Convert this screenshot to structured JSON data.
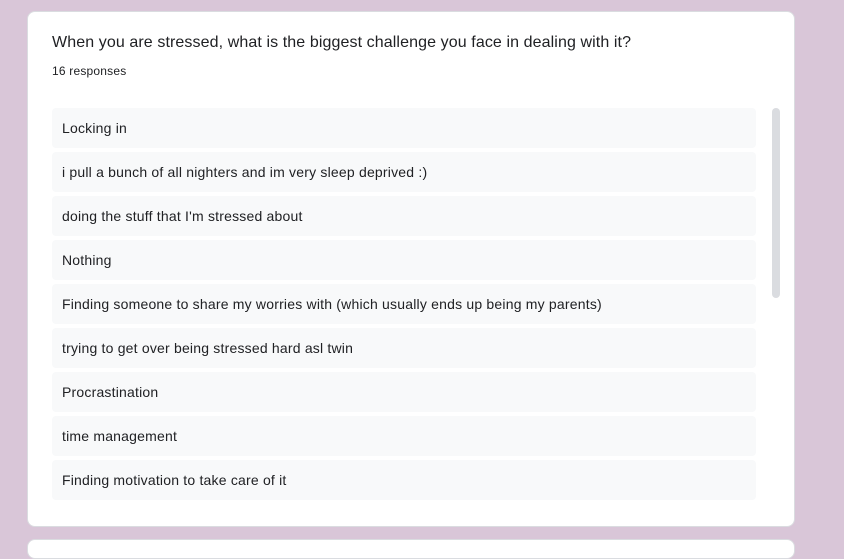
{
  "question": {
    "title": "When you are stressed, what is the biggest challenge you face in dealing with it?",
    "response_count": "16 responses"
  },
  "responses": [
    "Locking in",
    "i pull a bunch of all nighters and im very sleep deprived :)",
    "doing the stuff that I'm stressed about",
    "Nothing",
    "Finding someone to share my worries with (which usually ends up being my parents)",
    "trying to get over being stressed hard asl twin",
    "Procrastination",
    "time management",
    "Finding motivation to take care of it"
  ],
  "colors": {
    "background": "#d9c6d8",
    "card": "#ffffff",
    "response_row": "#f8f9fa",
    "scrollbar_thumb": "#dadce0",
    "text": "#202124"
  }
}
